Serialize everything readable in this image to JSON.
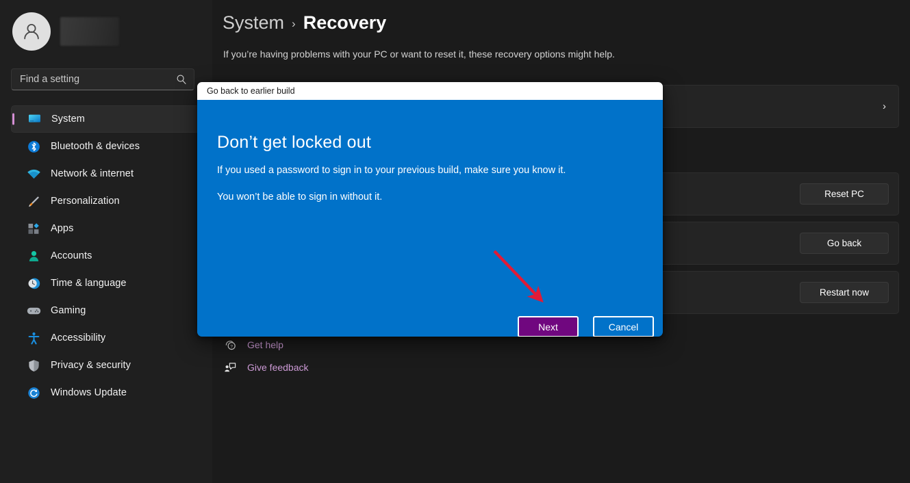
{
  "sidebar": {
    "profile": {
      "name_redacted": true,
      "avatar_icon": "person-avatar-icon"
    },
    "search": {
      "placeholder": "Find a setting",
      "value": "",
      "icon": "search-icon"
    },
    "items": [
      {
        "label": "System",
        "icon": "monitor-icon",
        "selected": true
      },
      {
        "label": "Bluetooth & devices",
        "icon": "bluetooth-icon",
        "selected": false
      },
      {
        "label": "Network & internet",
        "icon": "wifi-icon",
        "selected": false
      },
      {
        "label": "Personalization",
        "icon": "paintbrush-icon",
        "selected": false
      },
      {
        "label": "Apps",
        "icon": "apps-grid-icon",
        "selected": false
      },
      {
        "label": "Accounts",
        "icon": "person-icon",
        "selected": false
      },
      {
        "label": "Time & language",
        "icon": "clock-globe-icon",
        "selected": false
      },
      {
        "label": "Gaming",
        "icon": "gamepad-icon",
        "selected": false
      },
      {
        "label": "Accessibility",
        "icon": "accessibility-icon",
        "selected": false
      },
      {
        "label": "Privacy & security",
        "icon": "shield-icon",
        "selected": false
      },
      {
        "label": "Windows Update",
        "icon": "update-refresh-icon",
        "selected": false
      }
    ]
  },
  "header": {
    "breadcrumb_parent": "System",
    "breadcrumb_separator": "›",
    "breadcrumb_current": "Recovery",
    "subtitle": "If you’re having problems with your PC or want to reset it, these recovery options might help."
  },
  "main": {
    "cards": [
      {
        "action_type": "chevron",
        "chevron": "›"
      },
      {
        "action_type": "button",
        "button_label": "Reset PC"
      },
      {
        "action_type": "button",
        "button_label": "Go back"
      },
      {
        "action_type": "button",
        "button_label": "Restart now"
      }
    ],
    "links": [
      {
        "label": "Get help",
        "icon": "get-help-icon"
      },
      {
        "label": "Give feedback",
        "icon": "give-feedback-icon"
      }
    ]
  },
  "dialog": {
    "title": "Go back to earlier build",
    "heading": "Don’t get locked out",
    "paragraph_1": "If you used a password to sign in to your previous build, make sure you know it.",
    "paragraph_2": "You won’t be able to sign in without it.",
    "primary_button": "Next",
    "secondary_button": "Cancel"
  },
  "annotation": {
    "arrow_color": "#e01b37",
    "target": "Next"
  },
  "colors": {
    "dialog_blue": "#0172c9",
    "primary_button_purple": "#70077f",
    "link_accent": "#cd9bd6",
    "nav_selected_accent": "#d58fd5",
    "page_background": "#1b1b1b",
    "sidebar_background": "#1f1f1f",
    "card_background": "#242424"
  }
}
